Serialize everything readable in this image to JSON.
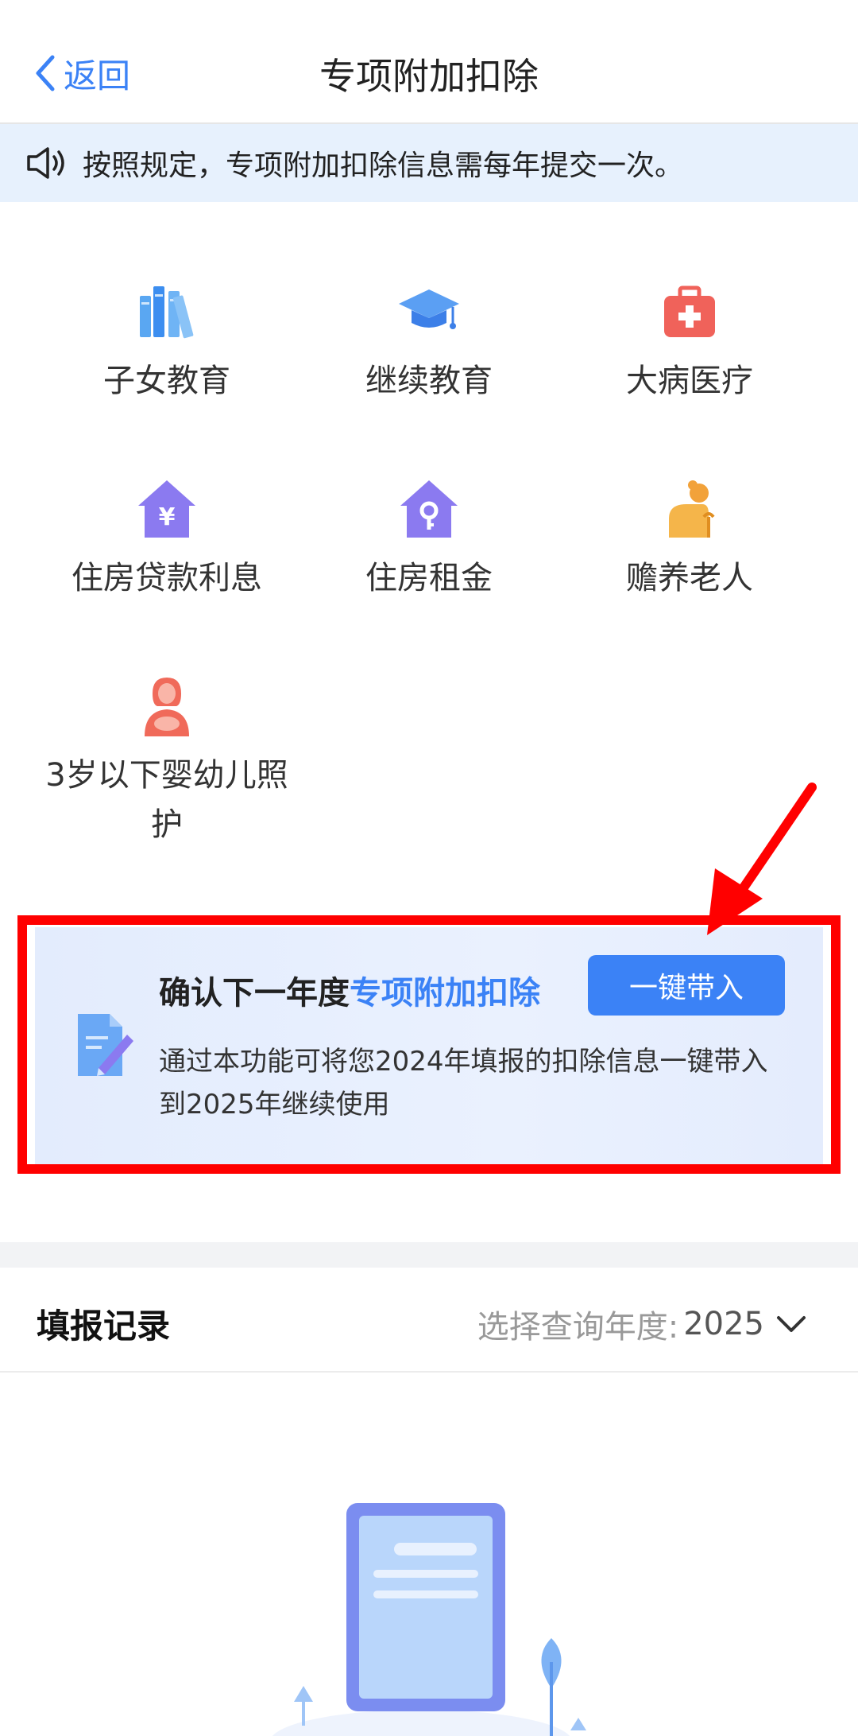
{
  "header": {
    "back_label": "返回",
    "title": "专项附加扣除"
  },
  "notice": {
    "text": "按照规定，专项附加扣除信息需每年提交一次。"
  },
  "categories": [
    {
      "label": "子女教育",
      "icon": "books-icon"
    },
    {
      "label": "继续教育",
      "icon": "graduation-cap-icon"
    },
    {
      "label": "大病医疗",
      "icon": "medical-kit-icon"
    },
    {
      "label": "住房贷款利息",
      "icon": "house-yen-icon"
    },
    {
      "label": "住房租金",
      "icon": "house-key-icon"
    },
    {
      "label": "赡养老人",
      "icon": "elderly-person-icon"
    },
    {
      "label": "3岁以下婴幼儿照护",
      "icon": "mother-baby-icon"
    }
  ],
  "banner": {
    "title_prefix": "确认下一年度",
    "title_highlight": "专项附加扣除",
    "button_label": "一键带入",
    "description": "通过本功能可将您2024年填报的扣除信息一键带入到2025年继续使用"
  },
  "records": {
    "title": "填报记录",
    "year_select_label": "选择查询年度:",
    "year_value": "2025"
  },
  "colors": {
    "accent": "#3b82f6",
    "highlight_frame": "#ff0000",
    "notice_bg": "#e7f1fd"
  }
}
